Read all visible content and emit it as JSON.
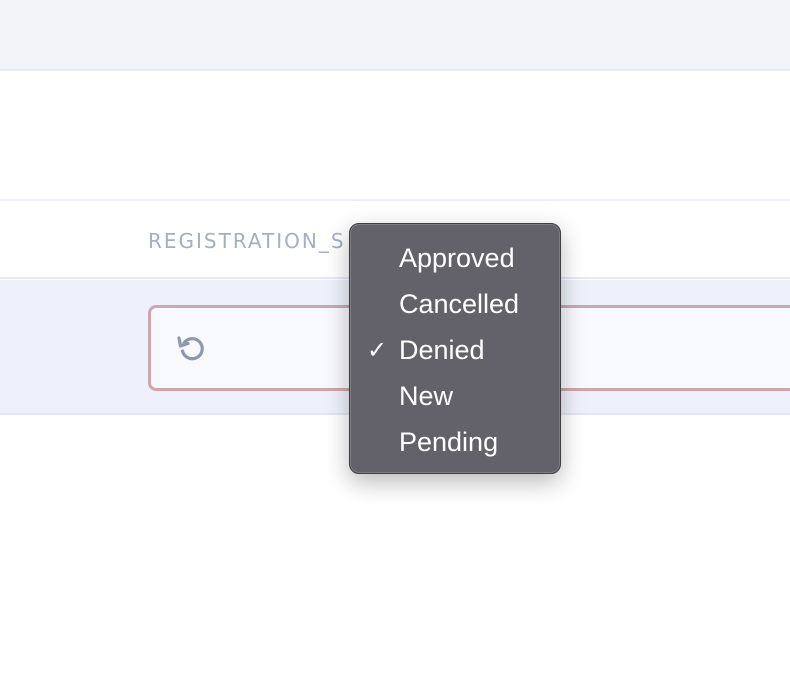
{
  "table": {
    "column_header": "REGISTRATION_S"
  },
  "row": {
    "reset_icon": "undo-icon"
  },
  "dropdown": {
    "items": [
      {
        "label": "Approved",
        "checked": false
      },
      {
        "label": "Cancelled",
        "checked": false
      },
      {
        "label": "Denied",
        "checked": true
      },
      {
        "label": "New",
        "checked": false
      },
      {
        "label": "Pending",
        "checked": false
      }
    ],
    "check_glyph": "✓"
  },
  "colors": {
    "field_border": "#cfa5ae",
    "menu_background": "#636169",
    "header_text": "#a6aebf",
    "row_background": "#eef1fb"
  }
}
